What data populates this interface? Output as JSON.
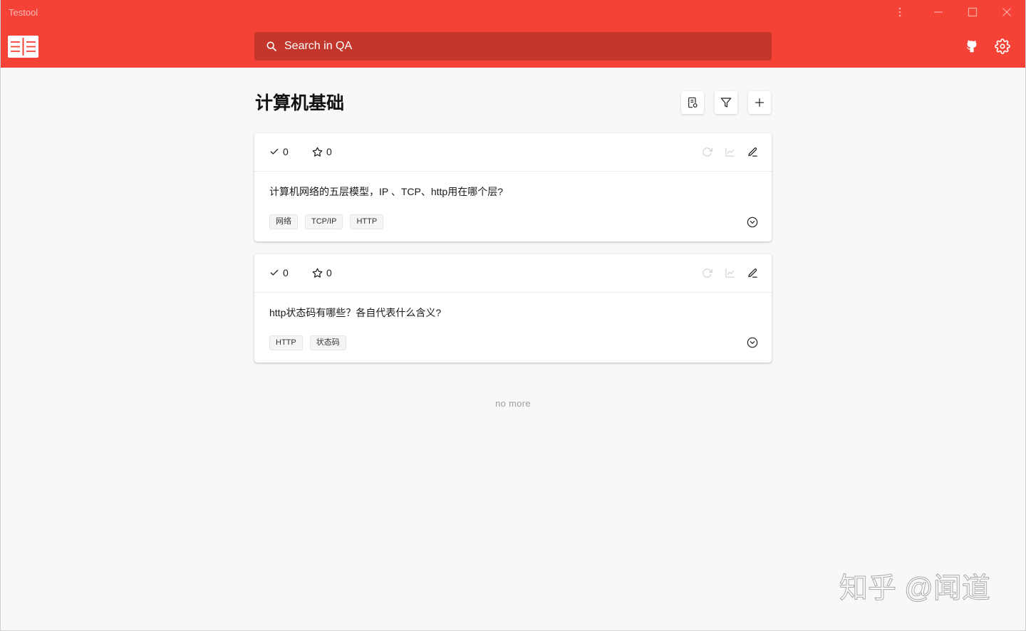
{
  "window": {
    "title": "Testool",
    "controls": [
      "more-vertical-icon",
      "minimize-icon",
      "maximize-icon",
      "close-icon"
    ]
  },
  "colors": {
    "header": "#f44336",
    "search_bar": "#c3362b",
    "background": "#f8f8fa",
    "text": "#1a1a1a",
    "muted": "#a0a0a0"
  },
  "header": {
    "menu_icon": "book-menu-icon",
    "search_icon": "search-icon",
    "search_placeholder": "Search in QA",
    "right_icons": [
      "github-icon",
      "settings-icon"
    ]
  },
  "page": {
    "title": "计算机基础",
    "toolbar": [
      "document-icon",
      "filter-icon",
      "plus-icon"
    ]
  },
  "questions": [
    {
      "done_count": "0",
      "star_count": "0",
      "text": "计算机网络的五层模型，IP 、TCP、http用在哪个层?",
      "tags": [
        "网络",
        "TCP/IP",
        "HTTP"
      ],
      "actions": [
        {
          "icon": "refresh-icon",
          "enabled": false
        },
        {
          "icon": "chart-icon",
          "enabled": false
        },
        {
          "icon": "edit-icon",
          "enabled": true
        }
      ],
      "expand_icon": "chevron-down-circle-icon"
    },
    {
      "done_count": "0",
      "star_count": "0",
      "text": "http状态码有哪些？各自代表什么含义?",
      "tags": [
        "HTTP",
        "状态码"
      ],
      "actions": [
        {
          "icon": "refresh-icon",
          "enabled": false
        },
        {
          "icon": "chart-icon",
          "enabled": false
        },
        {
          "icon": "edit-icon",
          "enabled": true
        }
      ],
      "expand_icon": "chevron-down-circle-icon"
    }
  ],
  "footer": {
    "end_text": "no more"
  },
  "watermark": "知乎 @闻道"
}
